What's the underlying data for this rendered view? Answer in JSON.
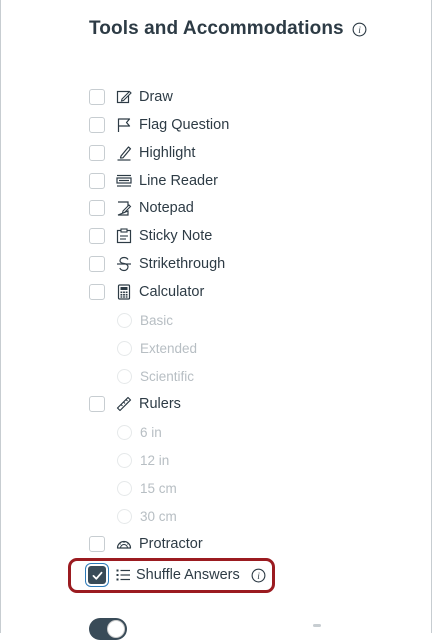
{
  "panel": {
    "title": "Tools and Accommodations"
  },
  "tools": [
    {
      "label": "Draw",
      "icon": "draw-icon",
      "checked": false
    },
    {
      "label": "Flag Question",
      "icon": "flag-icon",
      "checked": false
    },
    {
      "label": "Highlight",
      "icon": "highlighter-icon",
      "checked": false
    },
    {
      "label": "Line Reader",
      "icon": "line-reader-icon",
      "checked": false
    },
    {
      "label": "Notepad",
      "icon": "notepad-icon",
      "checked": false
    },
    {
      "label": "Sticky Note",
      "icon": "sticky-note-icon",
      "checked": false
    },
    {
      "label": "Strikethrough",
      "icon": "strikethrough-icon",
      "checked": false
    },
    {
      "label": "Calculator",
      "icon": "calculator-icon",
      "checked": false
    },
    {
      "label": "Rulers",
      "icon": "ruler-icon",
      "checked": false
    },
    {
      "label": "Protractor",
      "icon": "protractor-icon",
      "checked": false
    },
    {
      "label": "Shuffle Answers",
      "icon": "list-icon",
      "checked": true
    }
  ],
  "calculator_options": [
    {
      "label": "Basic"
    },
    {
      "label": "Extended"
    },
    {
      "label": "Scientific"
    }
  ],
  "ruler_options": [
    {
      "label": "6 in"
    },
    {
      "label": "12 in"
    },
    {
      "label": "15 cm"
    },
    {
      "label": "30 cm"
    }
  ],
  "colors": {
    "highlight_border": "#9b1b20",
    "checked_fill": "#394b58",
    "text": "#2d3b45",
    "disabled_text": "#b7bec3"
  }
}
